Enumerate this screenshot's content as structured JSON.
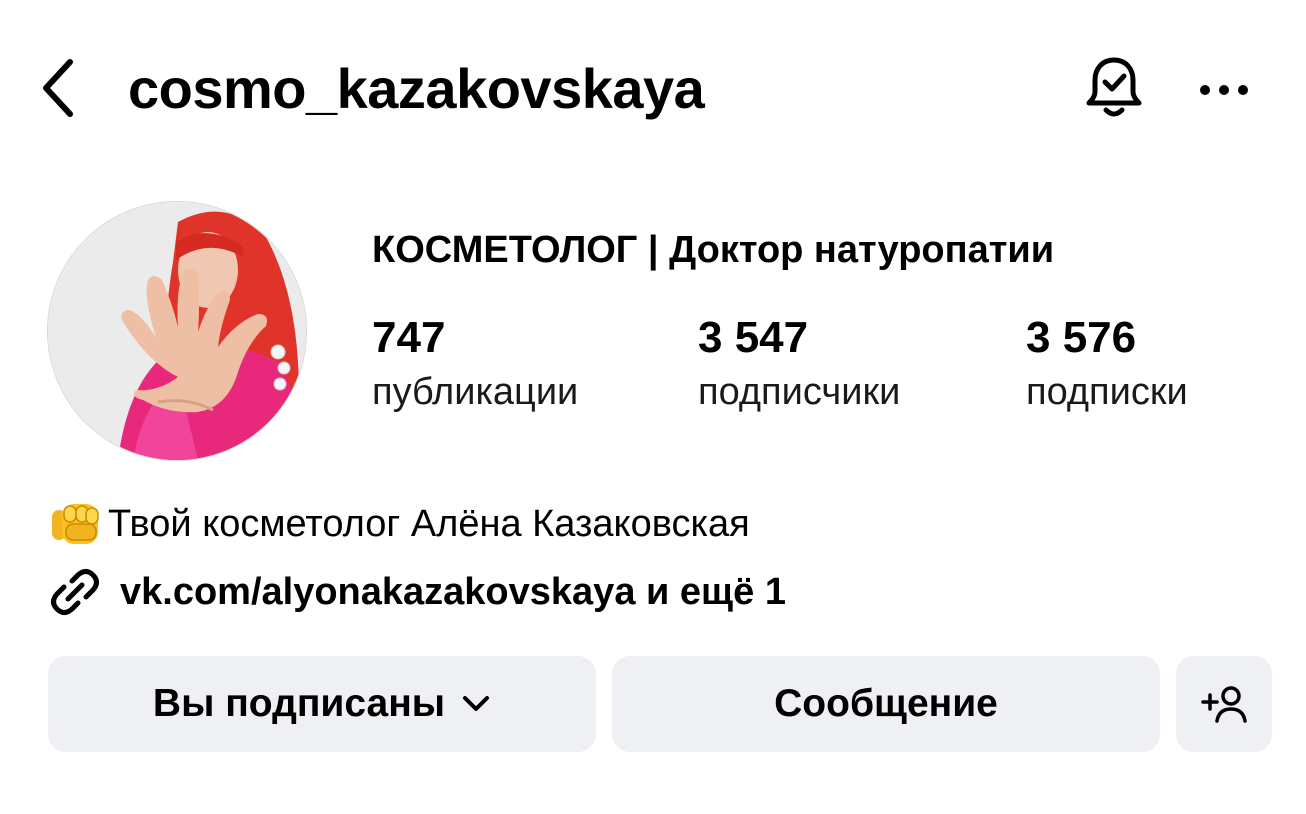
{
  "header": {
    "back_icon": "chevron-left-icon",
    "username": "cosmo_kazakovskaya",
    "notifications_icon": "bell-check-icon",
    "more_icon": "more-horizontal-icon"
  },
  "profile": {
    "avatar": "profile-photo",
    "category": "КОСМЕТОЛОГ | Доктор натуропатии",
    "stats": {
      "posts": {
        "value": "747",
        "label": "публикации"
      },
      "followers": {
        "value": "3 547",
        "label": "подписчики"
      },
      "following": {
        "value": "3 576",
        "label": "подписки"
      }
    },
    "bio": {
      "emoji_icon": "fist-emoji-icon",
      "text": "Твой косметолог Алёна Казаковская"
    },
    "link": {
      "icon": "link-icon",
      "text": "vk.com/alyonakazakovskaya и ещё 1"
    }
  },
  "actions": {
    "following_label": "Вы подписаны",
    "following_icon": "chevron-down-icon",
    "message_label": "Сообщение",
    "add_user_icon": "add-user-icon"
  },
  "colors": {
    "background": "#ffffff",
    "button_background": "#eff0f3",
    "text": "#000000",
    "avatar_outfit": "#e8287a",
    "avatar_hair": "#e0342b"
  }
}
